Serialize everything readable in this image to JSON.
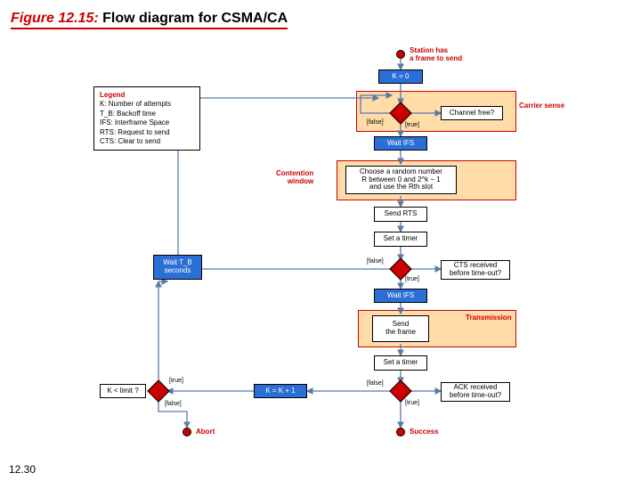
{
  "title": {
    "fignum": "Figure 12.15:",
    "rest": " Flow diagram for CSMA/CA"
  },
  "footer": "12.30",
  "legend": {
    "heading": "Legend",
    "l1": "K: Number of attempts",
    "l2": "T_B: Backoff time",
    "l3": "IFS: Interframe Space",
    "l4": "RTS: Request to send",
    "l5": "CTS: Clear to send"
  },
  "start": "Station has\na frame to send",
  "k0": "K = 0",
  "cs_label": "Carrier sense",
  "cf": "Channel free?",
  "wait_ifs1": "Wait IFS",
  "cw_label": "Contention\nwindow",
  "cw": "Choose a random number\nR between 0 and 2^k − 1\nand use the Rth slot",
  "rts": "Send RTS",
  "timer1": "Set a timer",
  "cts": "CTS received\nbefore time-out?",
  "wait_ifs2": "Wait IFS",
  "trans_label": "Transmission",
  "send_frame": "Send\nthe frame",
  "timer2": "Set a timer",
  "ack": "ACK received\nbefore time-out?",
  "wait_tb": "Wait T_B\nseconds",
  "klimit": "K < limit ?",
  "kinc": "K = K + 1",
  "abort": "Abort",
  "success": "Success",
  "tfalse": "[false]",
  "ttrue": "[true]"
}
